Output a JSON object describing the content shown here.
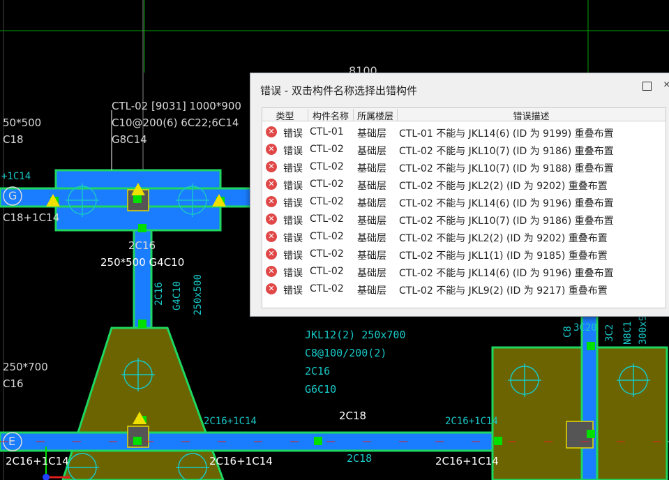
{
  "dialog": {
    "title": "错误 - 双击构件名称选择出错构件",
    "close_glyph": "×",
    "columns": [
      "类型",
      "构件名称",
      "所属楼层",
      "错误描述"
    ],
    "rows": [
      {
        "type": "错误",
        "name": "CTL-01",
        "floor": "基础层",
        "desc": "CTL-01 不能与 JKL14(6)  (ID 为 9199)  重叠布置"
      },
      {
        "type": "错误",
        "name": "CTL-02",
        "floor": "基础层",
        "desc": "CTL-02 不能与 JKL10(7)  (ID 为 9186)  重叠布置"
      },
      {
        "type": "错误",
        "name": "CTL-02",
        "floor": "基础层",
        "desc": "CTL-02 不能与 JKL10(7)  (ID 为 9188)  重叠布置"
      },
      {
        "type": "错误",
        "name": "CTL-02",
        "floor": "基础层",
        "desc": "CTL-02 不能与 JKL2(2)  (ID 为 9202)  重叠布置"
      },
      {
        "type": "错误",
        "name": "CTL-02",
        "floor": "基础层",
        "desc": "CTL-02 不能与 JKL14(6)  (ID 为 9196)  重叠布置"
      },
      {
        "type": "错误",
        "name": "CTL-02",
        "floor": "基础层",
        "desc": "CTL-02 不能与 JKL10(7)  (ID 为 9186)  重叠布置"
      },
      {
        "type": "错误",
        "name": "CTL-02",
        "floor": "基础层",
        "desc": "CTL-02 不能与 JKL2(2)  (ID 为 9202)  重叠布置"
      },
      {
        "type": "错误",
        "name": "CTL-02",
        "floor": "基础层",
        "desc": "CTL-02 不能与 JKL1(1)  (ID 为 9185)  重叠布置"
      },
      {
        "type": "错误",
        "name": "CTL-02",
        "floor": "基础层",
        "desc": "CTL-02 不能与 JKL14(6)  (ID 为 9196)  重叠布置"
      },
      {
        "type": "错误",
        "name": "CTL-02",
        "floor": "基础层",
        "desc": "CTL-02 不能与 JKL9(2)  (ID 为 9217)  重叠布置"
      }
    ]
  },
  "drawing": {
    "dim_top": "8100",
    "cap_label_line1": "CTL-02 [9031] 1000*900",
    "cap_label_line2": "C10@200(6) 6C22;6C14",
    "cap_label_line3": "G8C14",
    "left_label_1": "50*500",
    "left_label_2": "C18",
    "left_label_3": "C18+1C14",
    "left_label_4": "250*700",
    "left_label_5": "C16",
    "axis_g": "G",
    "axis_e": "E",
    "beam_2c16": "2C16",
    "beam_250x500": "250*500 G4C10",
    "beam_vert_1": "2C16",
    "beam_vert_2": "G4C10",
    "beam_vert_3": "250x500",
    "jkl_1": "JKL12(2) 250x700",
    "jkl_2": "C8@100/200(2)",
    "jkl_3": "2C16",
    "jkl_4": "G6C10",
    "bottom_2c18": "2C18",
    "bottom_2c18_cyan": "2C18",
    "bottom_2c16_1c14_a": "2C16+1C14",
    "bottom_2c16_1c14_b": "2C16+1C14",
    "bottom_2c16_1c14_c": "2C16+1C14",
    "bottom_2c16_1c14_d": "2C16+1C14",
    "bottom_2c16_1c14_e": "2C16+1C14",
    "right_3c20": "3C20",
    "right_vert_1": "C8",
    "right_vert_2": "3C2",
    "right_vert_3": "N8C1",
    "right_vert_4": "300x9",
    "top_left_partial": "+1C14",
    "colors": {
      "beam_blue": "#1a7cff",
      "footing_olive": "#6b6400",
      "outline_green": "#1ed760",
      "grid_green": "#00a000",
      "cyan": "#19c8c8",
      "error_red": "#e04848"
    }
  }
}
